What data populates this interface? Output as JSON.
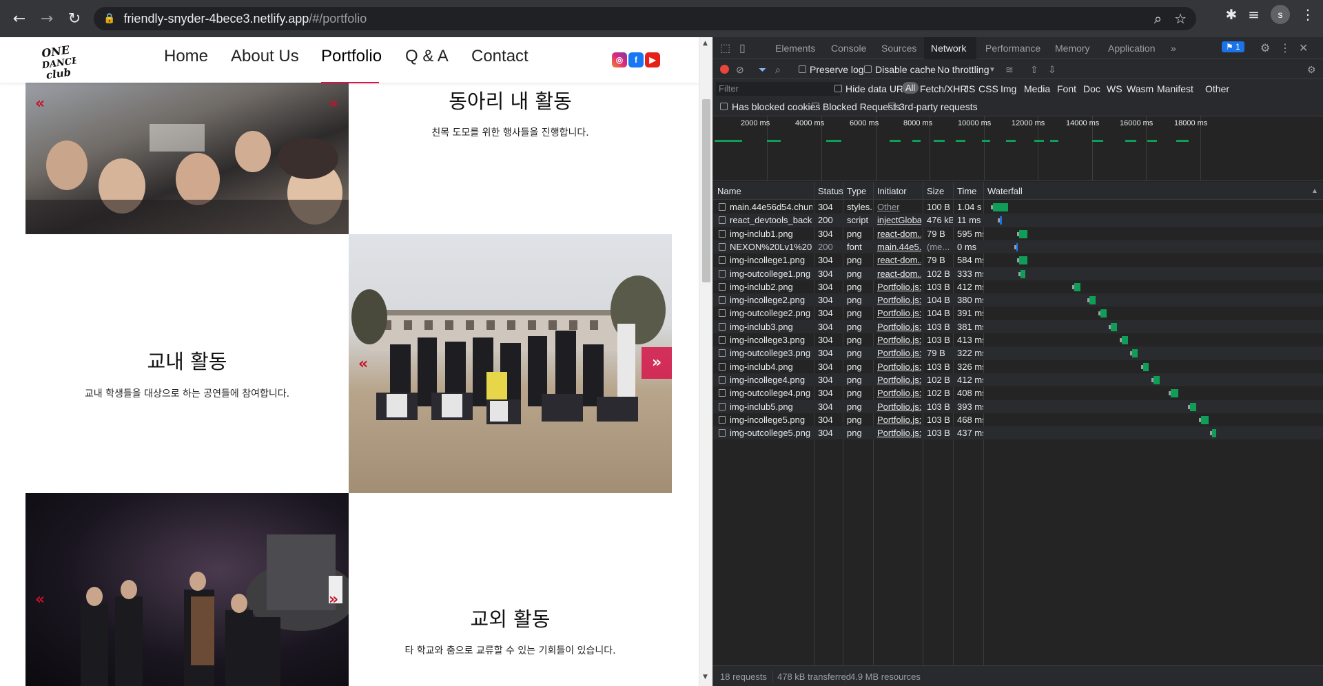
{
  "browser": {
    "url_host": "friendly-snyder-4bece3.netlify.app",
    "url_path": "/#/portfolio",
    "profile_initial": "s"
  },
  "site": {
    "logo_text": "ONE DANCE CLUB",
    "menu": [
      "Home",
      "About Us",
      "Portfolio",
      "Q & A",
      "Contact"
    ],
    "active_menu": "Portfolio",
    "social": [
      "instagram",
      "facebook",
      "youtube"
    ],
    "accent_color": "#d4154a",
    "sections": [
      {
        "title": "동아리 내 활동",
        "desc": "친목 도모를 위한 행사들을 진행합니다."
      },
      {
        "title": "교내 활동",
        "desc": "교내 학생들을 대상으로 하는 공연들에 참여합니다."
      },
      {
        "title": "교외 활동",
        "desc": "타 학교와 춤으로 교류할 수 있는 기회들이 있습니다."
      }
    ],
    "arrow_left": "«",
    "arrow_right": "»"
  },
  "devtools": {
    "tabs": [
      "Elements",
      "Console",
      "Sources",
      "Network",
      "Performance",
      "Memory",
      "Application"
    ],
    "active_tab": "Network",
    "more_tabs": "»",
    "issues_badge": "1",
    "toolbar": {
      "preserve_log": "Preserve log",
      "disable_cache": "Disable cache",
      "throttling": "No throttling"
    },
    "filter": {
      "placeholder": "Filter",
      "hide_data_urls": "Hide data URLs",
      "types": [
        "All",
        "Fetch/XHR",
        "JS",
        "CSS",
        "Img",
        "Media",
        "Font",
        "Doc",
        "WS",
        "Wasm",
        "Manifest",
        "Other"
      ],
      "has_blocked_cookies": "Has blocked cookies",
      "blocked_requests": "Blocked Requests",
      "third_party": "3rd-party requests"
    },
    "timeline_ticks": [
      "2000 ms",
      "4000 ms",
      "6000 ms",
      "8000 ms",
      "10000 ms",
      "12000 ms",
      "14000 ms",
      "16000 ms",
      "18000 ms"
    ],
    "columns": [
      "Name",
      "Status",
      "Type",
      "Initiator",
      "Size",
      "Time",
      "Waterfall"
    ],
    "rows": [
      {
        "name": "main.44e56d54.chunk....",
        "status": "304",
        "type": "styles...",
        "initiator": "Other",
        "size": "100 B",
        "time": "1.04 s",
        "icon": "css-file-icon"
      },
      {
        "name": "react_devtools_backen...",
        "status": "200",
        "type": "script",
        "initiator": "injectGloba...",
        "size": "476 kB",
        "time": "11 ms",
        "icon": "js-file-icon"
      },
      {
        "name": "img-inclub1.png",
        "status": "304",
        "type": "png",
        "initiator": "react-dom....",
        "size": "79 B",
        "time": "595 ms",
        "icon": "image-file-icon"
      },
      {
        "name": "NEXON%20Lv1%20Go...",
        "status": "200",
        "type": "font",
        "initiator": "main.44e5...",
        "size": "(me...",
        "time": "0 ms",
        "icon": "font-file-icon"
      },
      {
        "name": "img-incollege1.png",
        "status": "304",
        "type": "png",
        "initiator": "react-dom....",
        "size": "79 B",
        "time": "584 ms",
        "icon": "image-file-icon"
      },
      {
        "name": "img-outcollege1.png",
        "status": "304",
        "type": "png",
        "initiator": "react-dom....",
        "size": "102 B",
        "time": "333 ms",
        "icon": "image-file-icon"
      },
      {
        "name": "img-inclub2.png",
        "status": "304",
        "type": "png",
        "initiator": "Portfolio.js:...",
        "size": "103 B",
        "time": "412 ms",
        "icon": "image-file-icon"
      },
      {
        "name": "img-incollege2.png",
        "status": "304",
        "type": "png",
        "initiator": "Portfolio.js:...",
        "size": "104 B",
        "time": "380 ms",
        "icon": "image-file-icon"
      },
      {
        "name": "img-outcollege2.png",
        "status": "304",
        "type": "png",
        "initiator": "Portfolio.js:...",
        "size": "104 B",
        "time": "391 ms",
        "icon": "image-file-icon"
      },
      {
        "name": "img-inclub3.png",
        "status": "304",
        "type": "png",
        "initiator": "Portfolio.js:...",
        "size": "103 B",
        "time": "381 ms",
        "icon": "image-file-icon"
      },
      {
        "name": "img-incollege3.png",
        "status": "304",
        "type": "png",
        "initiator": "Portfolio.js:...",
        "size": "103 B",
        "time": "413 ms",
        "icon": "image-file-icon"
      },
      {
        "name": "img-outcollege3.png",
        "status": "304",
        "type": "png",
        "initiator": "Portfolio.js:...",
        "size": "79 B",
        "time": "322 ms",
        "icon": "image-file-icon"
      },
      {
        "name": "img-inclub4.png",
        "status": "304",
        "type": "png",
        "initiator": "Portfolio.js:...",
        "size": "103 B",
        "time": "326 ms",
        "icon": "image-file-icon"
      },
      {
        "name": "img-incollege4.png",
        "status": "304",
        "type": "png",
        "initiator": "Portfolio.js:...",
        "size": "102 B",
        "time": "412 ms",
        "icon": "image-file-icon"
      },
      {
        "name": "img-outcollege4.png",
        "status": "304",
        "type": "png",
        "initiator": "Portfolio.js:...",
        "size": "102 B",
        "time": "408 ms",
        "icon": "image-file-icon"
      },
      {
        "name": "img-inclub5.png",
        "status": "304",
        "type": "png",
        "initiator": "Portfolio.js:...",
        "size": "103 B",
        "time": "393 ms",
        "icon": "image-file-icon"
      },
      {
        "name": "img-incollege5.png",
        "status": "304",
        "type": "png",
        "initiator": "Portfolio.js:...",
        "size": "103 B",
        "time": "468 ms",
        "icon": "image-file-icon"
      },
      {
        "name": "img-outcollege5.png",
        "status": "304",
        "type": "png",
        "initiator": "Portfolio.js:...",
        "size": "103 B",
        "time": "437 ms",
        "icon": "image-file-icon"
      }
    ],
    "status_bar": {
      "requests": "18 requests",
      "transferred": "478 kB transferred",
      "resources": "4.9 MB resources"
    },
    "waterfall_color": "#0f9d58"
  }
}
